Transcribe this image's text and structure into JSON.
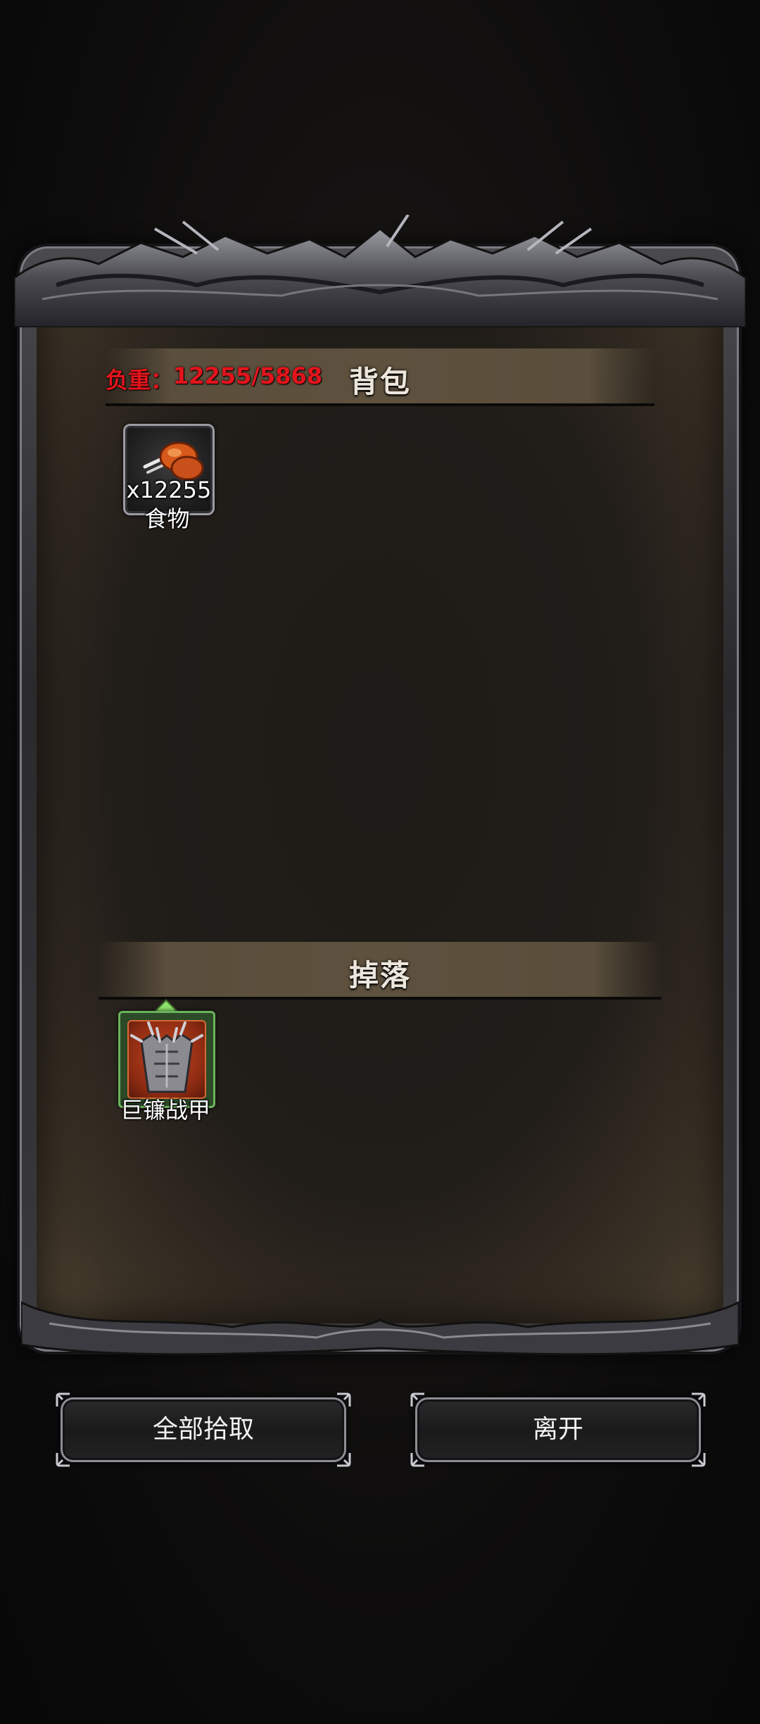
{
  "backpack": {
    "title": "背包",
    "weight_label": "负重：",
    "weight_value": "12255/5868",
    "items": [
      {
        "icon": "roast-meat-icon",
        "quantity": "x12255",
        "name": "食物"
      }
    ]
  },
  "drops": {
    "title": "掉落",
    "items": [
      {
        "icon": "armor-icon",
        "name": "巨镰战甲",
        "rarity_color": "#6bb25c"
      }
    ]
  },
  "buttons": {
    "pick_all": "全部拾取",
    "leave": "离开"
  },
  "colors": {
    "weight_text": "#e3141c",
    "header_bar": "#5e513e",
    "panel_bg": "#211d19"
  }
}
